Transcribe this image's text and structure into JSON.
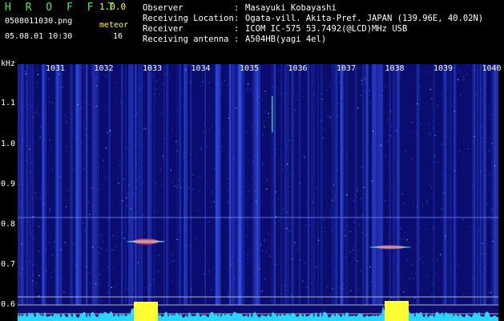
{
  "header": {
    "brand": "H R O F F T",
    "version": "1.0.0",
    "filename": "0508011030.png",
    "meteor_label": "meteor",
    "datetime": "05.08.01 10:30",
    "meteor_count": "16"
  },
  "station": {
    "rows": [
      {
        "key": "Observer",
        "value": "Masayuki Kobayashi"
      },
      {
        "key": "Receiving Location",
        "value": "Ogata-vill. Akita-Pref. JAPAN (139.96E, 40.02N)"
      },
      {
        "key": "Receiver",
        "value": "ICOM IC-575 53.7492(@LCD)MHz USB"
      },
      {
        "key": "Receiving antenna",
        "value": "A504HB(yagi 4el)"
      }
    ]
  },
  "spectrogram": {
    "y_unit": "kHz",
    "y_ticks": [
      "1.1",
      "1.0",
      "0.9",
      "0.8",
      "0.7",
      "0.6"
    ],
    "x_ticks": [
      "1031",
      "1032",
      "1033",
      "1034",
      "1035",
      "1036",
      "1037",
      "1038",
      "1039",
      "1040"
    ],
    "colors": {
      "background": "#0b0d6e",
      "noise": "#3b5bff",
      "baseline": "#29d6ff",
      "peak": "#ffff33",
      "echo": "#ff3355"
    }
  }
}
